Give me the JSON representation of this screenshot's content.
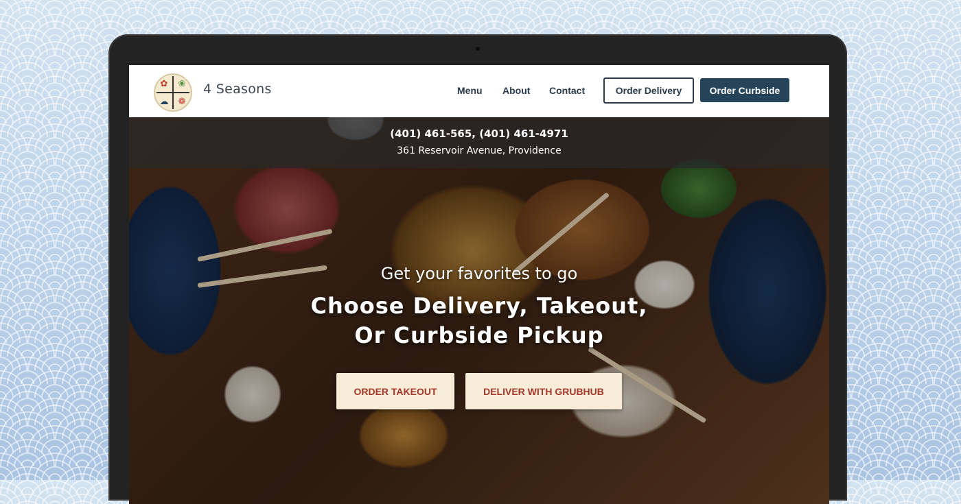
{
  "brand": {
    "name": "4 Seasons"
  },
  "nav": {
    "links": [
      "Menu",
      "About",
      "Contact"
    ],
    "order_delivery": "Order Delivery",
    "order_curbside": "Order Curbside"
  },
  "info": {
    "phones": "(401) 461-565, (401) 461-4971",
    "address": "361 Reservoir Avenue, Providence"
  },
  "hero": {
    "subtitle": "Get your favorites to go",
    "title_line1": "Choose Delivery, Takeout,",
    "title_line2": "Or Curbside Pickup",
    "cta_takeout": "ORDER TAKEOUT",
    "cta_grubhub": "DELIVER WITH GRUBHUB"
  },
  "colors": {
    "nav_text": "#2a3b4b",
    "primary_button": "#25445a",
    "cta_background": "#f7ecd7",
    "cta_text": "#a4362a"
  },
  "icons": [
    "logo-seasons-icon",
    "camera-icon"
  ]
}
